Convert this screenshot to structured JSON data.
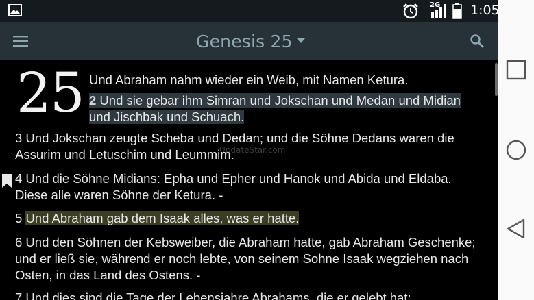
{
  "status_bar": {
    "network_label": "2G",
    "time": "1:05",
    "icons": [
      "gallery-icon",
      "alarm-icon",
      "signal-icon",
      "battery-icon"
    ]
  },
  "toolbar": {
    "title": "Genesis 25",
    "icons": [
      "menu-icon",
      "dropdown-icon",
      "search-icon"
    ],
    "background": "#263238",
    "title_color": "#8fa6ae"
  },
  "chapter": {
    "number": "25",
    "verses": [
      {
        "num": "",
        "lines": [
          "Und Abraham nahm wieder ein Weib, mit Namen Ketura."
        ]
      },
      {
        "num": "2",
        "lines": [
          " Und sie gebar ihm Simran und Jokschan und Medan und Midian",
          "und Jischbak und Schuach."
        ],
        "highlight": "#2f3a40"
      },
      {
        "num": "3",
        "lines": [
          " Und Jokschan zeugte Scheba und Dedan; und die Söhne Dedans waren die",
          "Assurim und Letuschim und Leummim."
        ]
      },
      {
        "num": "4",
        "lines": [
          " Und die Söhne Midians: Epha und Epher und Hanok und Abida und Eldaba.",
          "Diese alle waren Söhne der Ketura. -"
        ],
        "bookmarked": true
      },
      {
        "num": "5",
        "lines": [
          " ",
          "Und Abraham gab dem Isaak alles, was er hatte."
        ],
        "highlight": "#3c3d22"
      },
      {
        "num": "6",
        "lines": [
          " Und den Söhnen der Kebsweiber, die Abraham hatte, gab Abraham Geschenke;",
          "und er ließ sie, während er noch lebte, von seinem Sohne Isaak wegziehen nach",
          "Osten, in das Land des Ostens. -"
        ]
      },
      {
        "num": "7",
        "lines": [
          " Und dies sind die Tage der Lebensjahre Abrahams, die er gelebt hat:"
        ]
      }
    ]
  },
  "watermark": "UpdateStar.com",
  "nav_bar": {
    "icons": [
      "recents-square-icon",
      "home-circle-icon",
      "back-triangle-icon"
    ]
  }
}
